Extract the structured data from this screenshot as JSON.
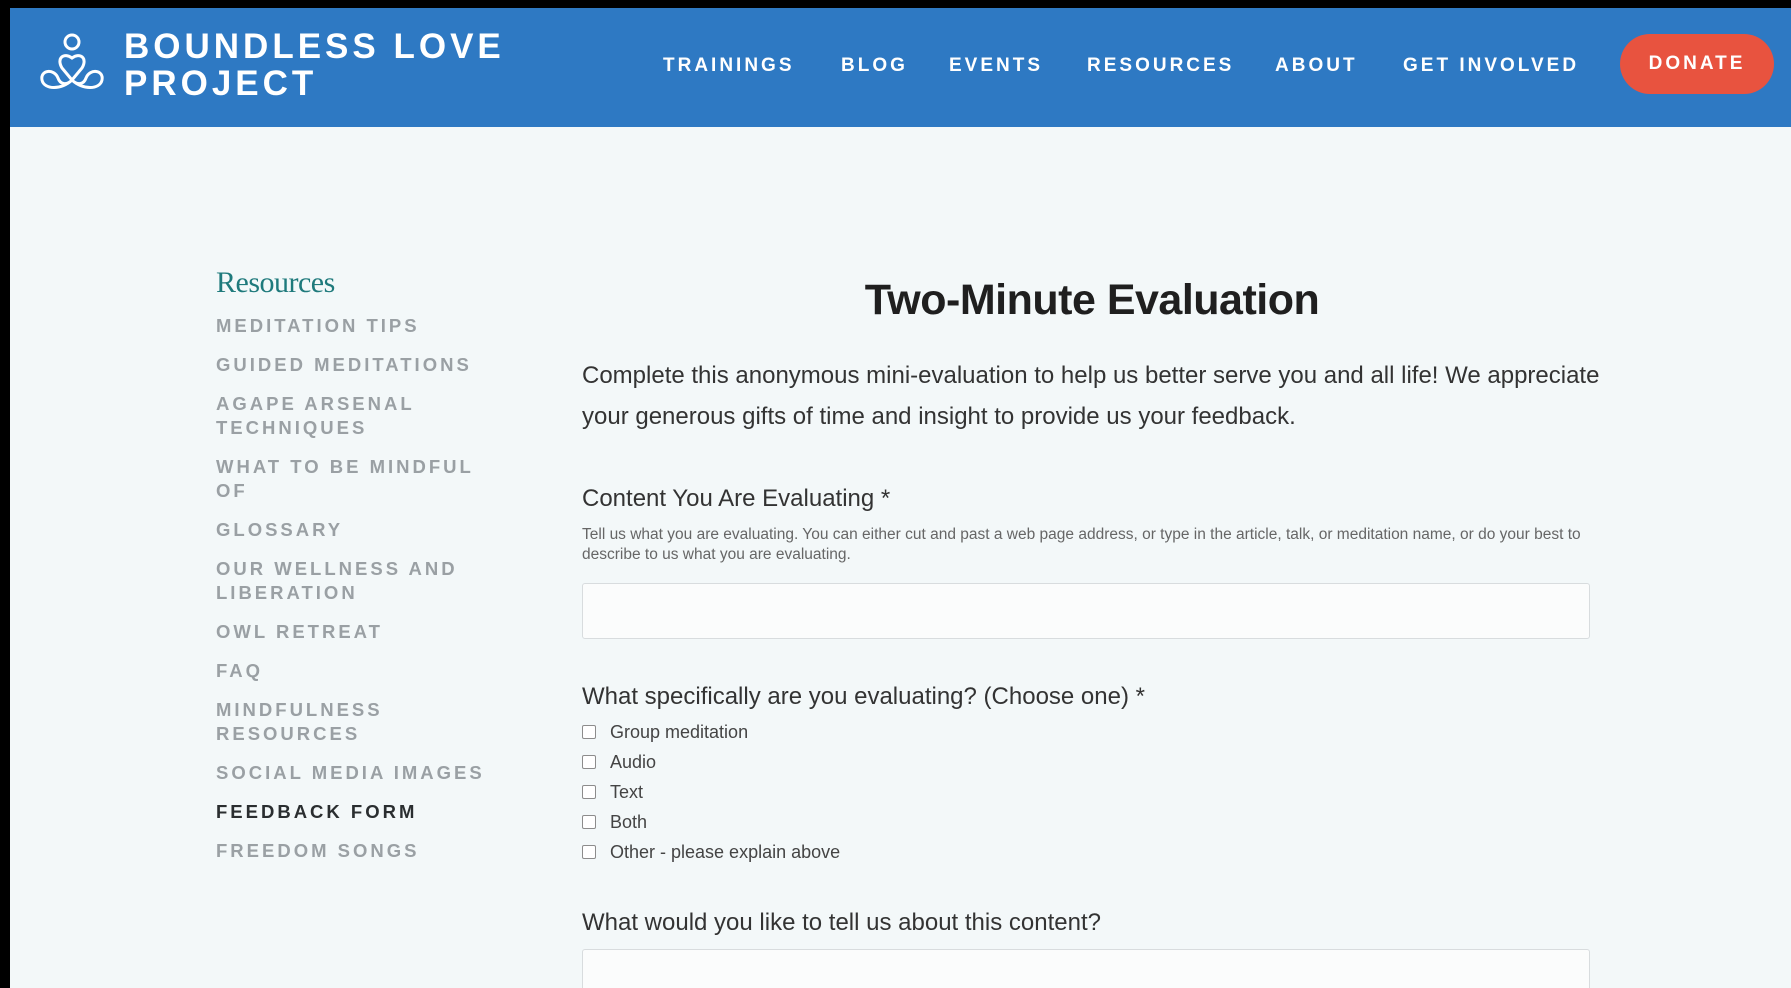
{
  "brand": {
    "line1": "BOUNDLESS LOVE",
    "line2": "PROJECT",
    "logo_icon": "meditating-heart-logo"
  },
  "nav": {
    "items": [
      "TRAININGS",
      "BLOG",
      "EVENTS",
      "RESOURCES",
      "ABOUT",
      "GET INVOLVED"
    ],
    "donate": "DONATE"
  },
  "sidebar": {
    "title": "Resources",
    "links": [
      {
        "label": "MEDITATION TIPS"
      },
      {
        "label": "GUIDED MEDITATIONS"
      },
      {
        "label": "AGAPE ARSENAL TECHNIQUES"
      },
      {
        "label": "WHAT TO BE MINDFUL OF"
      },
      {
        "label": "GLOSSARY"
      },
      {
        "label": "OUR WELLNESS AND LIBERATION"
      },
      {
        "label": "OWL RETREAT"
      },
      {
        "label": "FAQ"
      },
      {
        "label": "MINDFULNESS RESOURCES"
      },
      {
        "label": "SOCIAL MEDIA IMAGES"
      },
      {
        "label": "FEEDBACK FORM",
        "active": true
      },
      {
        "label": "FREEDOM SONGS"
      }
    ]
  },
  "main": {
    "title": "Two-Minute Evaluation",
    "intro": "Complete this anonymous mini-evaluation to help us better serve you and all life! We appreciate your generous gifts of time and insight to provide us your feedback.",
    "content_label": "Content You Are Evaluating *",
    "content_help": "Tell us what you are evaluating. You can either cut and past a web page address, or type in the article, talk, or meditation name, or do your best to describe to us what you are evaluating.",
    "content_value": "",
    "type_label": "What specifically are you evaluating? (Choose one) *",
    "options": [
      "Group meditation",
      "Audio",
      "Text",
      "Both",
      "Other - please explain above"
    ],
    "tell_label": "What would you like to tell us about this content?",
    "tell_value": ""
  },
  "colors": {
    "header": "#2e79c3",
    "donate": "#e8533f",
    "sidebar_title": "#1f7a7c",
    "page_bg": "#f3f8f9"
  }
}
